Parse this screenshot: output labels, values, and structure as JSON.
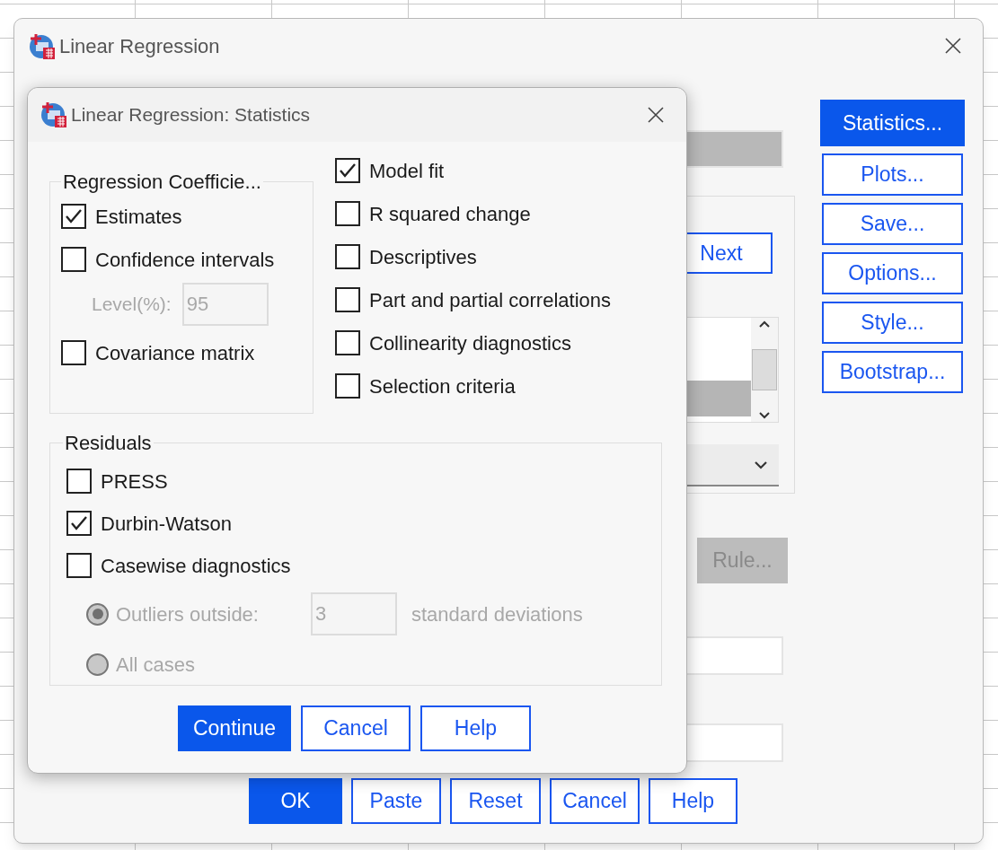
{
  "main_window": {
    "title": "Linear Regression",
    "side_buttons": [
      {
        "label": "Statistics...",
        "selected": true
      },
      {
        "label": "Plots...",
        "selected": false
      },
      {
        "label": "Save...",
        "selected": false
      },
      {
        "label": "Options...",
        "selected": false
      },
      {
        "label": "Style...",
        "selected": false
      },
      {
        "label": "Bootstrap...",
        "selected": false
      }
    ],
    "next_button": {
      "label": "Next"
    },
    "rule_button": {
      "label": "Rule...",
      "disabled": true
    },
    "bottom_buttons": [
      {
        "label": "OK",
        "default": true
      },
      {
        "label": "Paste",
        "default": false
      },
      {
        "label": "Reset",
        "default": false
      },
      {
        "label": "Cancel",
        "default": false
      },
      {
        "label": "Help",
        "default": false
      }
    ]
  },
  "statistics_dialog": {
    "title": "Linear Regression: Statistics",
    "coefficients": {
      "title": "Regression Coefficie...",
      "options": [
        {
          "label": "Estimates",
          "checked": true
        },
        {
          "label": "Confidence intervals",
          "checked": false
        }
      ],
      "level": {
        "label": "Level(%):",
        "value": "95",
        "disabled": true
      },
      "covariance": {
        "label": "Covariance matrix",
        "checked": false
      }
    },
    "other_options": [
      {
        "label": "Model fit",
        "checked": true
      },
      {
        "label": "R squared change",
        "checked": false
      },
      {
        "label": "Descriptives",
        "checked": false
      },
      {
        "label": "Part and partial correlations",
        "checked": false
      },
      {
        "label": "Collinearity diagnostics",
        "checked": false
      },
      {
        "label": "Selection criteria",
        "checked": false
      }
    ],
    "residuals": {
      "title": "Residuals",
      "options": [
        {
          "label": "PRESS",
          "checked": false
        },
        {
          "label": "Durbin-Watson",
          "checked": true
        },
        {
          "label": "Casewise diagnostics",
          "checked": false
        }
      ],
      "outliers": {
        "label": "Outliers outside:",
        "selected": true,
        "disabled": true,
        "value": "3",
        "unit": "standard deviations"
      },
      "all_cases": {
        "label": "All cases",
        "selected": false,
        "disabled": true
      }
    },
    "buttons": [
      {
        "label": "Continue",
        "default": true
      },
      {
        "label": "Cancel",
        "default": false
      },
      {
        "label": "Help",
        "default": false
      }
    ]
  }
}
